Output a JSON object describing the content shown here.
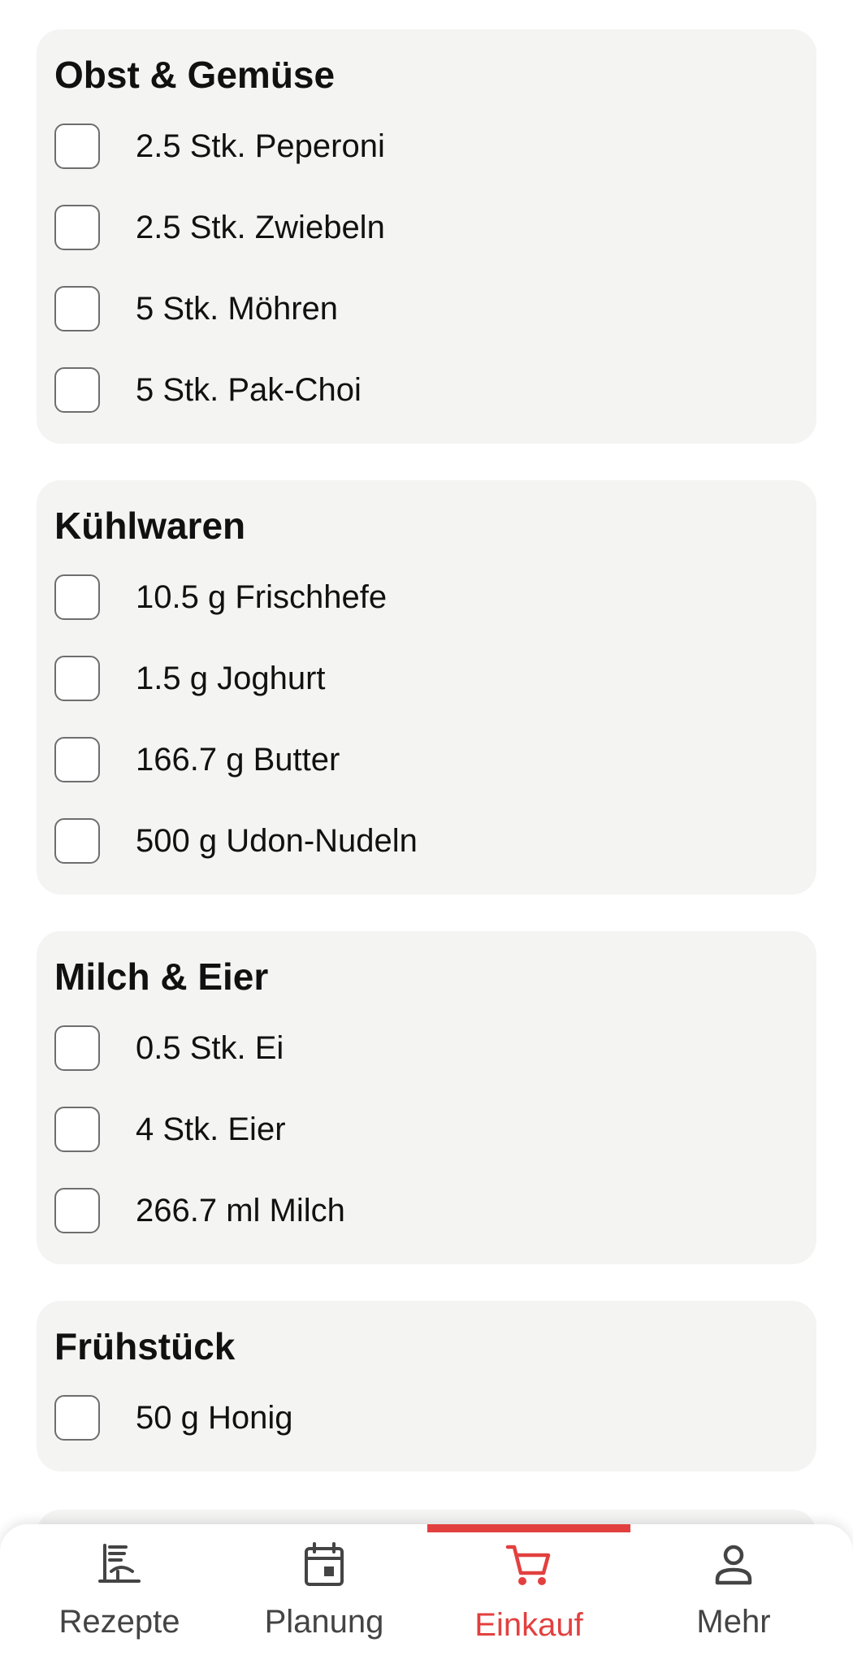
{
  "shopping_list": {
    "categories": [
      {
        "title": "Obst & Gemüse",
        "items": [
          "2.5 Stk. Peperoni",
          "2.5 Stk. Zwiebeln",
          "5 Stk. Möhren",
          "5 Stk. Pak-Choi"
        ]
      },
      {
        "title": "Kühlwaren",
        "items": [
          "10.5 g Frischhefe",
          "1.5 g Joghurt",
          "166.7 g Butter",
          "500 g Udon-Nudeln"
        ]
      },
      {
        "title": "Milch & Eier",
        "items": [
          "0.5 Stk. Ei",
          "4 Stk. Eier",
          "266.7 ml Milch"
        ]
      },
      {
        "title": "Frühstück",
        "items": [
          "50 g Honig"
        ]
      }
    ]
  },
  "bottom_nav": {
    "items": [
      {
        "label": "Rezepte",
        "icon": "recipes-icon",
        "active": false
      },
      {
        "label": "Planung",
        "icon": "calendar-icon",
        "active": false
      },
      {
        "label": "Einkauf",
        "icon": "shopping-cart-icon",
        "active": true
      },
      {
        "label": "Mehr",
        "icon": "person-icon",
        "active": false
      }
    ]
  },
  "colors": {
    "accent": "#e2403f",
    "card_background": "#f4f4f3",
    "icon_inactive": "#444444"
  }
}
